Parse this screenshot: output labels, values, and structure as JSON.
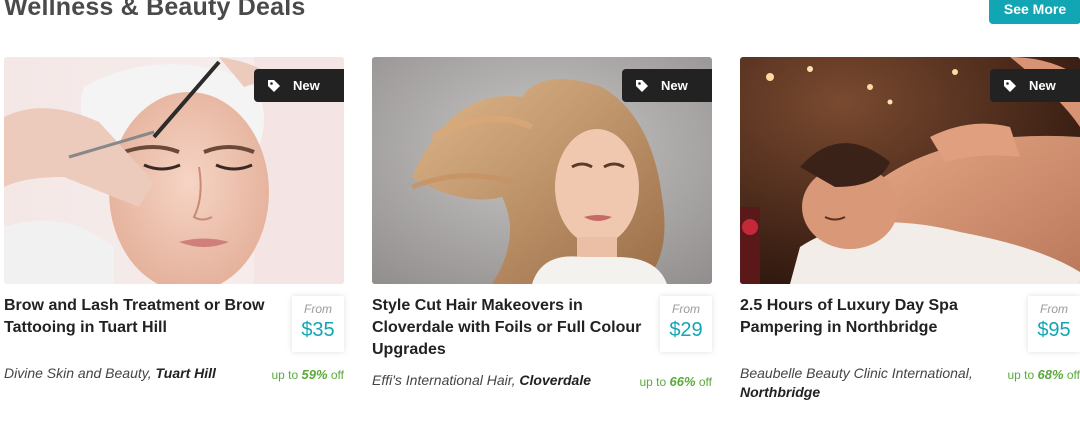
{
  "section": {
    "title": "Wellness & Beauty Deals",
    "see_more_label": "See More"
  },
  "colors": {
    "accent": "#12a6b4",
    "badge_bg": "#222222",
    "discount": "#5aaa3c"
  },
  "deals": [
    {
      "badge": "New",
      "title": "Brow and Lash Treatment or Brow Tattooing in Tuart Hill",
      "price_prefix": "From",
      "price": "$35",
      "merchant": "Divine Skin and Beauty,",
      "location": "Tuart Hill",
      "discount_prefix": "up to",
      "discount_pct": "59%",
      "discount_suffix": "off",
      "image_icon": "brow-treatment-photo"
    },
    {
      "badge": "New",
      "title": "Style Cut Hair Makeovers in Cloverdale with Foils or Full Colour Upgrades",
      "price_prefix": "From",
      "price": "$29",
      "merchant": "Effi's International Hair,",
      "location": "Cloverdale",
      "discount_prefix": "up to",
      "discount_pct": "66%",
      "discount_suffix": "off",
      "image_icon": "hair-model-photo"
    },
    {
      "badge": "New",
      "title": "2.5 Hours of Luxury Day Spa Pampering in Northbridge",
      "price_prefix": "From",
      "price": "$95",
      "merchant": "Beaubelle Beauty Clinic International,",
      "location": "Northbridge",
      "discount_prefix": "up to",
      "discount_pct": "68%",
      "discount_suffix": "off",
      "image_icon": "spa-massage-photo"
    }
  ]
}
